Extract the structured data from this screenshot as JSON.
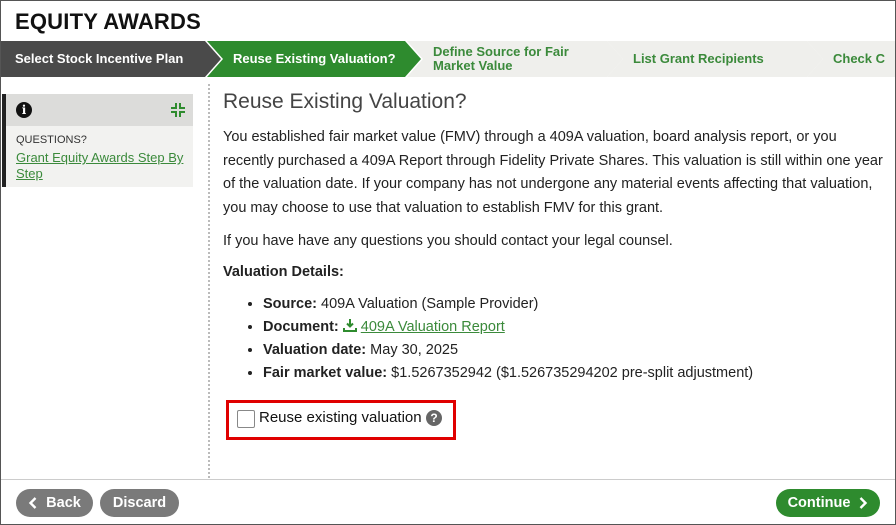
{
  "app": {
    "title": "EQUITY AWARDS"
  },
  "stepper": {
    "steps": [
      {
        "label": "Select Stock Incentive Plan",
        "state": "completed"
      },
      {
        "label": "Reuse Existing Valuation?",
        "state": "active"
      },
      {
        "label": "Define Source for Fair Market Value",
        "state": "upcoming"
      },
      {
        "label": "List Grant Recipients",
        "state": "upcoming"
      },
      {
        "label": "Check C",
        "state": "upcoming"
      }
    ]
  },
  "sidebar": {
    "info_icon": "info-icon",
    "collapse_icon": "collapse-icon",
    "questions_label": "QUESTIONS?",
    "help_link": "Grant Equity Awards Step By Step"
  },
  "main": {
    "title": "Reuse Existing Valuation?",
    "intro": "You established fair market value (FMV) through a 409A valuation, board analysis report, or you recently purchased a 409A Report through Fidelity Private Shares. This valuation is still within one year of the valuation date. If your company has not undergone any material events affecting that valuation, you may choose to use that valuation to establish FMV for this grant.",
    "legal_note": "If you have have any questions you should contact your legal counsel.",
    "details_heading": "Valuation Details:",
    "details": {
      "source_label": "Source:",
      "source_value": "409A Valuation (Sample Provider)",
      "document_label": "Document:",
      "document_link": "409A Valuation Report",
      "date_label": "Valuation date:",
      "date_value": "May 30, 2025",
      "fmv_label": "Fair market value:",
      "fmv_value": "$1.5267352942 ($1.526735294202 pre-split adjustment)"
    },
    "reuse_checkbox": {
      "label": "Reuse existing valuation",
      "checked": false,
      "help_icon": "?"
    }
  },
  "footer": {
    "back_label": "Back",
    "discard_label": "Discard",
    "continue_label": "Continue"
  },
  "colors": {
    "accent_green": "#3b8a3b",
    "active_step": "#2e8b2e",
    "completed_step": "#4a4a4a",
    "upcoming_step": "#efefec",
    "highlight": "#e00000"
  }
}
